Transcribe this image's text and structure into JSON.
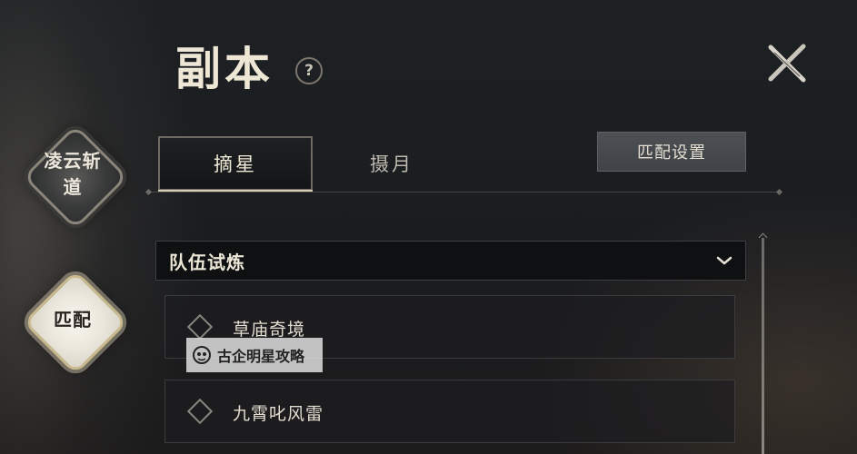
{
  "header": {
    "title": "副本",
    "help_icon": "?"
  },
  "sidebar": {
    "items": [
      {
        "label": "凌云斩道",
        "active": false
      },
      {
        "label": "匹配",
        "active": true
      }
    ]
  },
  "tabs": [
    {
      "label": "摘星",
      "active": true
    },
    {
      "label": "摄月",
      "active": false
    }
  ],
  "match_settings_label": "匹配设置",
  "dropdown": {
    "selected": "队伍试炼"
  },
  "list": [
    {
      "label": "草庙奇境",
      "checked": false
    },
    {
      "label": "九霄叱风雷",
      "checked": false
    }
  ],
  "watermark": {
    "text": "古企明星攻略"
  },
  "colors": {
    "accent": "#d9cfb6",
    "background": "#1c1e21"
  }
}
